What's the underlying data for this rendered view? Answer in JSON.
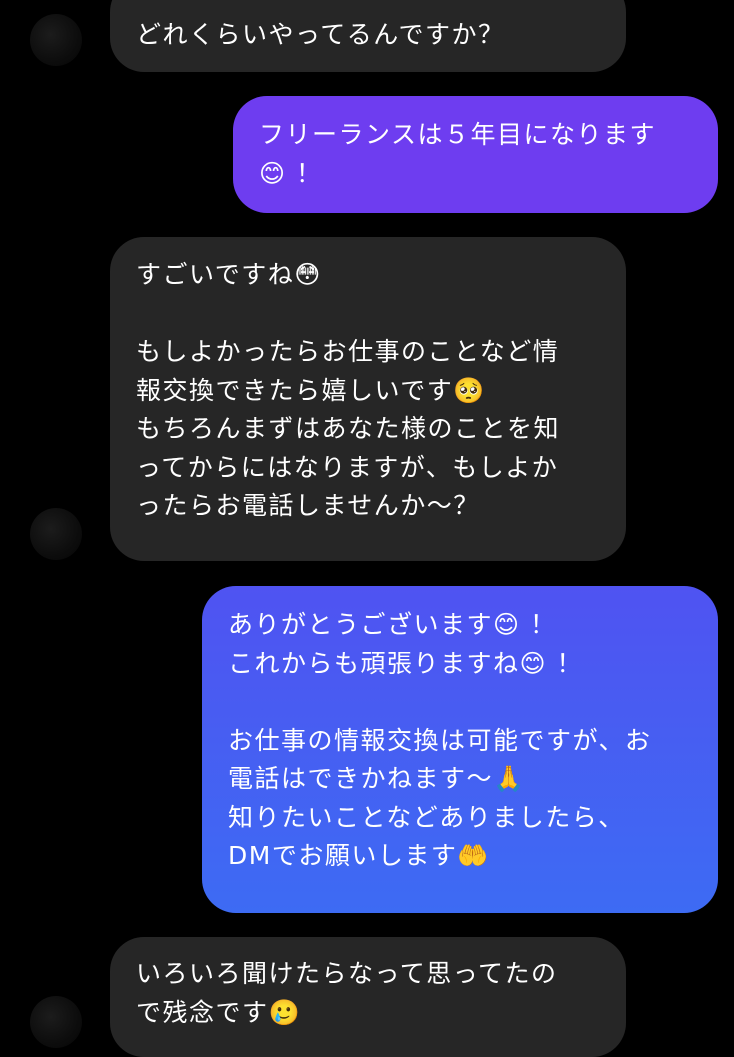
{
  "messages": [
    {
      "direction": "incoming",
      "lines": [
        "どれくらいやってるんですか？"
      ]
    },
    {
      "direction": "outgoing",
      "lines": [
        "フリーランスは５年目になります",
        "😊 ！"
      ]
    },
    {
      "direction": "incoming",
      "lines": [
        "すごいですね😳",
        "",
        "もしよかったらお仕事のことなど情",
        "報交換できたら嬉しいです🥺",
        "もちろんまずはあなた様のことを知",
        "ってからにはなりますが、もしよか",
        "ったらお電話しませんか〜？"
      ]
    },
    {
      "direction": "outgoing",
      "lines": [
        "ありがとうございます😊 ！",
        "これからも頑張りますね😊 ！",
        "",
        "お仕事の情報交換は可能ですが、お",
        "電話はできかねます〜🙏",
        "知りたいことなどありましたら、",
        "DMでお願いします🤲"
      ]
    },
    {
      "direction": "incoming",
      "lines": [
        "いろいろ聞けたらなって思ってたの",
        "で残念です🥲"
      ]
    }
  ],
  "colors": {
    "background": "#000000",
    "incoming_bubble": "#262626",
    "outgoing_bubble_purple": "#6e3df0",
    "outgoing_bubble_blue": "#4a5cf2",
    "text": "#ffffff"
  }
}
